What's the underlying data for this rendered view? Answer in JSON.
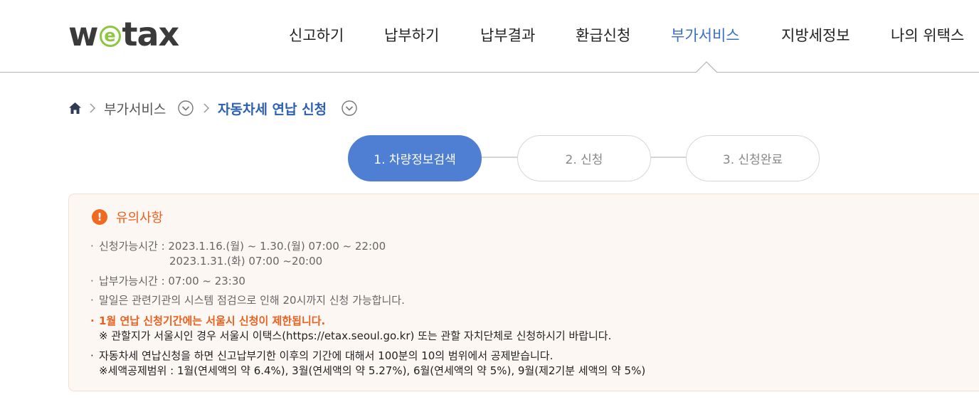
{
  "header": {
    "logo": {
      "pre": "w",
      "mid": "e",
      "post": "tax"
    },
    "nav": [
      {
        "label": "신고하기",
        "active": false
      },
      {
        "label": "납부하기",
        "active": false
      },
      {
        "label": "납부결과",
        "active": false
      },
      {
        "label": "환급신청",
        "active": false
      },
      {
        "label": "부가서비스",
        "active": true
      },
      {
        "label": "지방세정보",
        "active": false
      },
      {
        "label": "나의 위택스",
        "active": false
      }
    ]
  },
  "breadcrumb": {
    "home_icon": "home-icon",
    "section": "부가서비스",
    "current": "자동차세 연납 신청"
  },
  "steps": [
    {
      "label": "1. 차량정보검색",
      "active": true
    },
    {
      "label": "2. 신청",
      "active": false
    },
    {
      "label": "3. 신청완료",
      "active": false
    }
  ],
  "notice": {
    "title": "유의사항",
    "apply_time_label": "신청가능시간 : ",
    "apply_time_1": "2023.1.16.(월) ~ 1.30.(월) 07:00 ~ 22:00",
    "apply_time_2": "2023.1.31.(화) 07:00 ~20:00",
    "pay_time": "납부가능시간 : 07:00 ~ 23:30",
    "weekend_note": "말일은 관련기관의 시스템 점검으로 인해 20시까지 신청 가능합니다.",
    "seoul_warning": "1월 연납 신청기간에는 서울시 신청이 제한됩니다.",
    "seoul_note": "※ 관할지가 서울시인 경우 서울시 이택스(https://etax.seoul.go.kr) 또는 관할 자치단체로 신청하시기 바랍니다.",
    "deduction_note": "자동차세 연납신청을 하면 신고납부기한 이후의 기간에 대해서 100분의 10의 범위에서 공제받습니다.",
    "deduction_range": "※세액공제범위 : 1월(연세액의 약 6.4%), 3월(연세액의 약 5.27%), 6월(연세액의 약 5%), 9월(제2기분 세액의 약 5%)"
  },
  "colors": {
    "accent": "#3a6fc8",
    "step_active": "#4e7fd3",
    "warning": "#e8611f",
    "logo_green": "#8dc63f"
  }
}
